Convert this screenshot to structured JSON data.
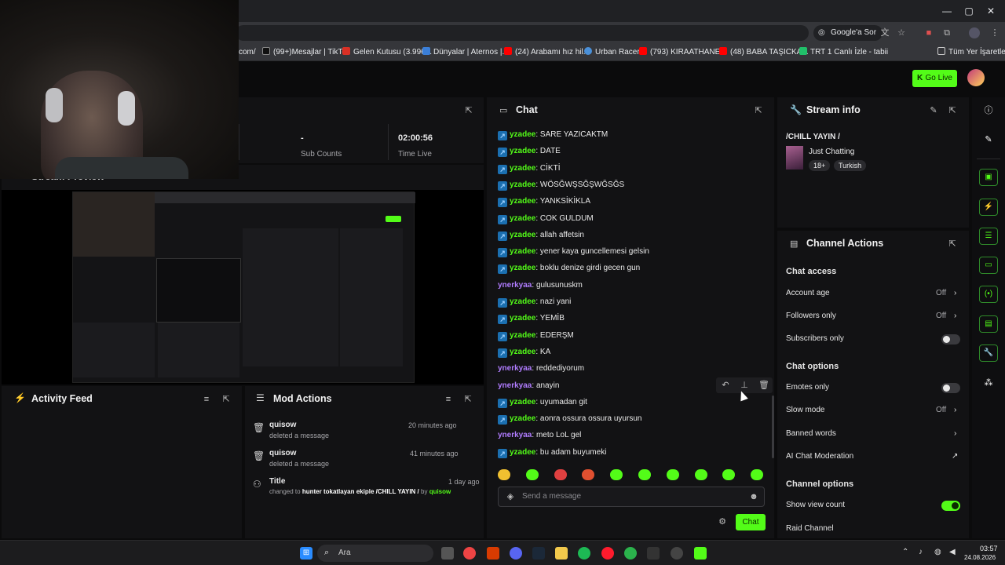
{
  "browser": {
    "window_controls": {
      "minimize": "—",
      "maximize": "▢",
      "close": "✕"
    },
    "google_button": "Google'a Sor",
    "url_fragment": "com/",
    "bookmarks": [
      {
        "label": "(99+)Mesajlar | TikTok",
        "color": "#111111"
      },
      {
        "label": "Gelen Kutusu (3.996...",
        "color": "#d93025"
      },
      {
        "label": "Dünyalar | Aternos |...",
        "color": "#3b7fd8"
      },
      {
        "label": "(24) Arabamı hız hil...",
        "color": "#ff0000"
      },
      {
        "label": "Urban Racer",
        "color": "#4a90d9"
      },
      {
        "label": "(793) KIRAATHANE...",
        "color": "#ff0000"
      },
      {
        "label": "(48) BABA TAŞICKA...",
        "color": "#ff0000"
      },
      {
        "label": "TRT 1 Canlı İzle - tabii",
        "color": "#21c06a"
      }
    ],
    "all_bookmarks": "Tüm Yer İşaretleri"
  },
  "header": {
    "go_live": "Go Live"
  },
  "stats": {
    "sub_counts_value": "-",
    "sub_counts_label": "Sub Counts",
    "time_live_value": "02:00:56",
    "time_live_label": "Time Live",
    "stream_preview_label": "Stream Preview"
  },
  "chat": {
    "title": "Chat",
    "messages": [
      {
        "user": "yzadee",
        "badge": true,
        "text": "SARE YAZICAKTM"
      },
      {
        "user": "yzadee",
        "badge": true,
        "text": "DATE"
      },
      {
        "user": "yzadee",
        "badge": true,
        "text": "CİKTİ"
      },
      {
        "user": "yzadee",
        "badge": true,
        "text": "WÖSĞWŞSĞŞWĞSĞS"
      },
      {
        "user": "yzadee",
        "badge": true,
        "text": "YANKSİKİKLA"
      },
      {
        "user": "yzadee",
        "badge": true,
        "text": "COK GULDUM"
      },
      {
        "user": "yzadee",
        "badge": true,
        "text": "allah affetsin"
      },
      {
        "user": "yzadee",
        "badge": true,
        "text": "yener kaya guncellemesi gelsin"
      },
      {
        "user": "yzadee",
        "badge": true,
        "text": "boklu denize girdi gecen gun"
      },
      {
        "user": "ynerkyaa",
        "badge": false,
        "text": "gulusunuskm"
      },
      {
        "user": "yzadee",
        "badge": true,
        "text": "nazi yani"
      },
      {
        "user": "yzadee",
        "badge": true,
        "text": "YEMİB"
      },
      {
        "user": "yzadee",
        "badge": true,
        "text": "EDERŞM"
      },
      {
        "user": "yzadee",
        "badge": true,
        "text": "KA"
      },
      {
        "user": "ynerkyaa",
        "badge": false,
        "text": "reddediyorum"
      },
      {
        "user": "ynerkyaa",
        "badge": false,
        "text": "anayin"
      },
      {
        "user": "yzadee",
        "badge": true,
        "text": "uyumadan git"
      },
      {
        "user": "yzadee",
        "badge": true,
        "text": "aonra ossura ossura uyursun"
      },
      {
        "user": "ynerkyaa",
        "badge": false,
        "text": "meto LoL gel"
      },
      {
        "user": "yzadee",
        "badge": true,
        "text": "bu adam buyumeki"
      }
    ],
    "input_placeholder": "Send a message",
    "send_button": "Chat"
  },
  "activity_feed": {
    "title": "Activity Feed"
  },
  "mod_actions": {
    "title": "Mod Actions",
    "items": [
      {
        "user": "quisow",
        "action": "deleted a message",
        "time": "20 minutes ago"
      },
      {
        "user": "quisow",
        "action": "deleted a message",
        "time": "41 minutes ago"
      }
    ],
    "title_change": {
      "heading": "Title",
      "time": "1 day ago",
      "prefix": "changed to",
      "new_title": "hunter tokatlayan ekiple /CHILL YAYIN /",
      "by": "by",
      "user": "quisow"
    }
  },
  "stream_info": {
    "title": "Stream info",
    "stream_title": "/CHILL YAYIN /",
    "category": "Just Chatting",
    "tags": [
      "18+",
      "Turkish"
    ]
  },
  "channel_actions": {
    "title": "Channel Actions",
    "chat_access": "Chat access",
    "account_age": {
      "label": "Account age",
      "value": "Off"
    },
    "followers_only": {
      "label": "Followers only",
      "value": "Off"
    },
    "subscribers_only": {
      "label": "Subscribers only",
      "enabled": false
    },
    "chat_options": "Chat options",
    "emotes_only": {
      "label": "Emotes only",
      "enabled": false
    },
    "slow_mode": {
      "label": "Slow mode",
      "value": "Off"
    },
    "banned_words": {
      "label": "Banned words"
    },
    "ai_moderation": {
      "label": "AI Chat Moderation"
    },
    "channel_options": "Channel options",
    "show_view_count": {
      "label": "Show view count",
      "enabled": true
    },
    "raid_channel": {
      "label": "Raid Channel"
    }
  },
  "taskbar": {
    "search_placeholder": "Ara",
    "time": "03:57",
    "date": "24.08.2026"
  },
  "colors": {
    "accent": "#53fc18",
    "badge_blue": "#1b6fb0",
    "purple_user": "#b07cff"
  }
}
